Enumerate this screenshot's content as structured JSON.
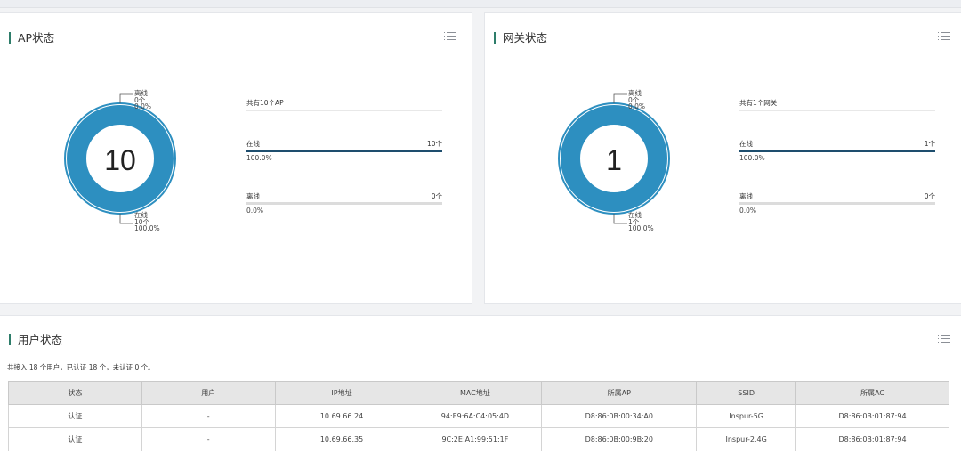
{
  "ap_panel": {
    "title": "AP状态",
    "donut_center": "10",
    "callout_top": {
      "label": "离线",
      "count": "0个",
      "pct": "0.0%"
    },
    "callout_bottom": {
      "label": "在线",
      "count": "10个",
      "pct": "100.0%"
    },
    "summary": "共有10个AP",
    "online": {
      "label": "在线",
      "count": "10个",
      "pct": "100.0%",
      "fraction": 1.0
    },
    "offline": {
      "label": "离线",
      "count": "0个",
      "pct": "0.0%",
      "fraction": 0.0
    }
  },
  "gw_panel": {
    "title": "网关状态",
    "donut_center": "1",
    "callout_top": {
      "label": "离线",
      "count": "0个",
      "pct": "0.0%"
    },
    "callout_bottom": {
      "label": "在线",
      "count": "1个",
      "pct": "100.0%"
    },
    "summary": "共有1个网关",
    "online": {
      "label": "在线",
      "count": "1个",
      "pct": "100.0%",
      "fraction": 1.0
    },
    "offline": {
      "label": "离线",
      "count": "0个",
      "pct": "0.0%",
      "fraction": 0.0
    }
  },
  "user_panel": {
    "title": "用户状态",
    "summary": "共接入 18 个用户，已认证 18 个，未认证 0 个。",
    "columns": [
      "状态",
      "用户",
      "IP地址",
      "MAC地址",
      "所属AP",
      "SSID",
      "所属AC"
    ],
    "rows": [
      [
        "认证",
        "-",
        "10.69.66.24",
        "94:E9:6A:C4:05:4D",
        "D8:86:0B:00:34:A0",
        "Inspur-5G",
        "D8:86:0B:01:87:94"
      ],
      [
        "认证",
        "-",
        "10.69.66.35",
        "9C:2E:A1:99:51:1F",
        "D8:86:0B:00:9B:20",
        "Inspur-2.4G",
        "D8:86:0B:01:87:94"
      ]
    ]
  },
  "colors": {
    "donut_fill": "#2d8fc0",
    "donut_ring": "#2d8fc0",
    "bar_fill": "#1e4e6e",
    "accent": "#2e7d6a"
  },
  "icons": {
    "panel_menu": "list-menu-icon"
  }
}
